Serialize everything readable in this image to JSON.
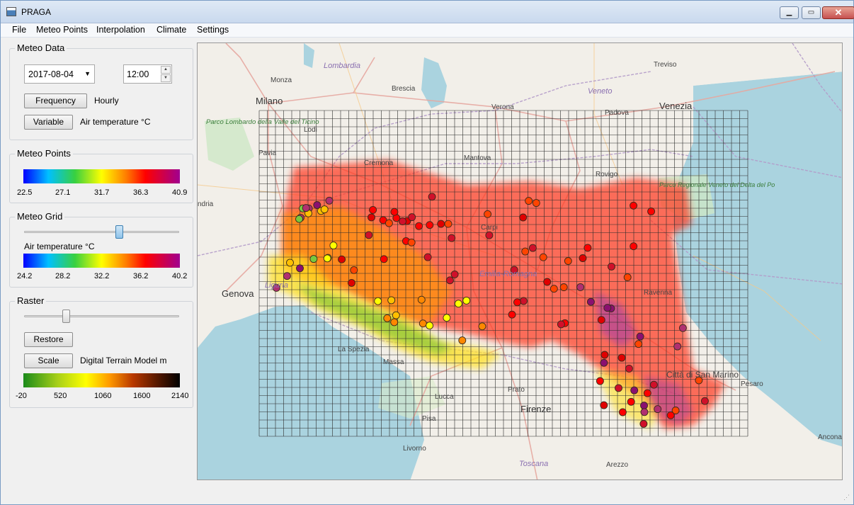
{
  "window": {
    "title": "PRAGA",
    "min_label": "▁",
    "max_label": "▭",
    "close_label": "✕"
  },
  "menu": [
    {
      "label": "File"
    },
    {
      "label": "Meteo Points"
    },
    {
      "label": "Interpolation"
    },
    {
      "label": "Climate"
    },
    {
      "label": "Settings"
    }
  ],
  "meteo_data": {
    "title": "Meteo Data",
    "date": "2017-08-04",
    "time": "12:00",
    "frequency_button": "Frequency",
    "frequency_value": "Hourly",
    "variable_button": "Variable",
    "variable_value": "Air temperature °C"
  },
  "meteo_points": {
    "title": "Meteo Points",
    "legend_ticks": [
      "22.5",
      "27.1",
      "31.7",
      "36.3",
      "40.9"
    ]
  },
  "meteo_grid": {
    "title": "Meteo Grid",
    "slider_value": 0.62,
    "variable_label": "Air temperature °C",
    "legend_ticks": [
      "24.2",
      "28.2",
      "32.2",
      "36.2",
      "40.2"
    ]
  },
  "raster": {
    "title": "Raster",
    "slider_value": 0.27,
    "restore_button": "Restore",
    "scale_button": "Scale",
    "scale_label": "Digital Terrain Model m",
    "legend_ticks": [
      "-20",
      "520",
      "1060",
      "1600",
      "2140"
    ]
  },
  "map": {
    "cities": [
      {
        "name": "Milano",
        "kind": "city"
      },
      {
        "name": "Venezia",
        "kind": "city"
      },
      {
        "name": "Genova",
        "kind": "city"
      },
      {
        "name": "Firenze",
        "kind": "city"
      },
      {
        "name": "Monza",
        "kind": "town"
      },
      {
        "name": "Brescia",
        "kind": "town"
      },
      {
        "name": "Verona",
        "kind": "town"
      },
      {
        "name": "Padova",
        "kind": "town"
      },
      {
        "name": "Treviso",
        "kind": "town"
      },
      {
        "name": "Lodi",
        "kind": "town"
      },
      {
        "name": "Pavia",
        "kind": "town"
      },
      {
        "name": "Cremona",
        "kind": "town"
      },
      {
        "name": "Mantova",
        "kind": "town"
      },
      {
        "name": "Rovigo",
        "kind": "town"
      },
      {
        "name": "Carpi",
        "kind": "town"
      },
      {
        "name": "Ravenna",
        "kind": "town"
      },
      {
        "name": "La Spezia",
        "kind": "town"
      },
      {
        "name": "Massa",
        "kind": "town"
      },
      {
        "name": "Prato",
        "kind": "town"
      },
      {
        "name": "Lucca",
        "kind": "town"
      },
      {
        "name": "Pisa",
        "kind": "town"
      },
      {
        "name": "Livorno",
        "kind": "town"
      },
      {
        "name": "Arezzo",
        "kind": "town"
      },
      {
        "name": "Pesaro",
        "kind": "town"
      },
      {
        "name": "Ancona",
        "kind": "town"
      },
      {
        "name": "Città di San Marino",
        "kind": "town"
      },
      {
        "name": "ndria",
        "kind": "town"
      }
    ],
    "regions": [
      "Lombardia",
      "Veneto",
      "Emilia-Romagna",
      "Liguria",
      "Toscana"
    ],
    "parks": [
      "Parco Lombardo della Valle del Ticino",
      "Parco Regionale Veneto del Delta del Po"
    ]
  },
  "colors": {
    "window_bg": "#f0f0f0",
    "sea": "#aad3df",
    "land": "#f2efe9",
    "grid_line": "#2b2b2b"
  }
}
